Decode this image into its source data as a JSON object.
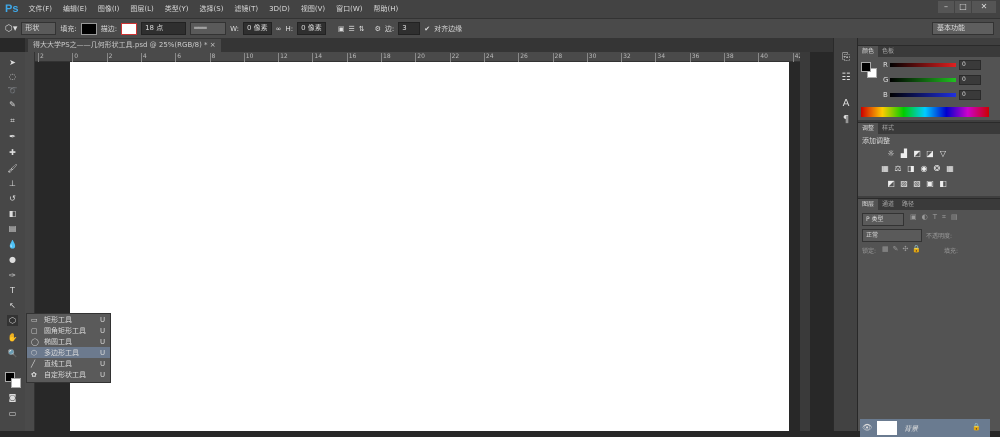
{
  "app": {
    "logo": "Ps"
  },
  "menu": [
    "文件(F)",
    "编辑(E)",
    "图像(I)",
    "图层(L)",
    "类型(Y)",
    "选择(S)",
    "滤镜(T)",
    "3D(D)",
    "视图(V)",
    "窗口(W)",
    "帮助(H)"
  ],
  "options": {
    "mode": "形状",
    "fill_label": "填充:",
    "stroke_label": "描边:",
    "stroke_width": "18 点",
    "w_label": "W:",
    "w_value": "0 像素",
    "h_label": "H:",
    "h_value": "0 像素",
    "sides_label": "边:",
    "sides_value": "3",
    "align_edges": "对齐边缘",
    "align_checked": true,
    "fill_color": "#000000"
  },
  "workspace": "基本功能",
  "document": {
    "tab": "得大大学PS之——几何形状工具.psd @ 25%(RGB/8) *",
    "close": "×"
  },
  "ruler": [
    "2",
    "0",
    "2",
    "4",
    "6",
    "8",
    "10",
    "12",
    "14",
    "16",
    "18",
    "20",
    "22",
    "24",
    "26",
    "28",
    "30",
    "32",
    "34",
    "36",
    "38",
    "40",
    "42"
  ],
  "flyout": [
    {
      "icon": "rectangle-icon",
      "glyph": "▭",
      "label": "矩形工具",
      "key": "U",
      "selected": false
    },
    {
      "icon": "rounded-rectangle-icon",
      "glyph": "▢",
      "label": "圆角矩形工具",
      "key": "U",
      "selected": false
    },
    {
      "icon": "ellipse-icon",
      "glyph": "◯",
      "label": "椭圆工具",
      "key": "U",
      "selected": false
    },
    {
      "icon": "polygon-icon",
      "glyph": "⬡",
      "label": "多边形工具",
      "key": "U",
      "selected": true
    },
    {
      "icon": "line-icon",
      "glyph": "╱",
      "label": "直线工具",
      "key": "U",
      "selected": false
    },
    {
      "icon": "custom-shape-icon",
      "glyph": "✿",
      "label": "自定形状工具",
      "key": "U",
      "selected": false
    }
  ],
  "color_panel": {
    "tabs": [
      "颜色",
      "色板"
    ],
    "channels": [
      {
        "label": "R",
        "value": "0",
        "color": "#d02020"
      },
      {
        "label": "G",
        "value": "0",
        "color": "#20a020"
      },
      {
        "label": "B",
        "value": "0",
        "color": "#2030c0"
      }
    ]
  },
  "adjust_panel": {
    "tabs": [
      "调整",
      "样式"
    ],
    "title": "添加调整"
  },
  "layers_panel": {
    "tabs": [
      "图层",
      "通道",
      "路径"
    ],
    "filter": "P 类型",
    "blend": "正常",
    "opacity_label": "不透明度:",
    "lock_label": "锁定:",
    "fill_label": "填充:",
    "layer_name": "背景"
  }
}
